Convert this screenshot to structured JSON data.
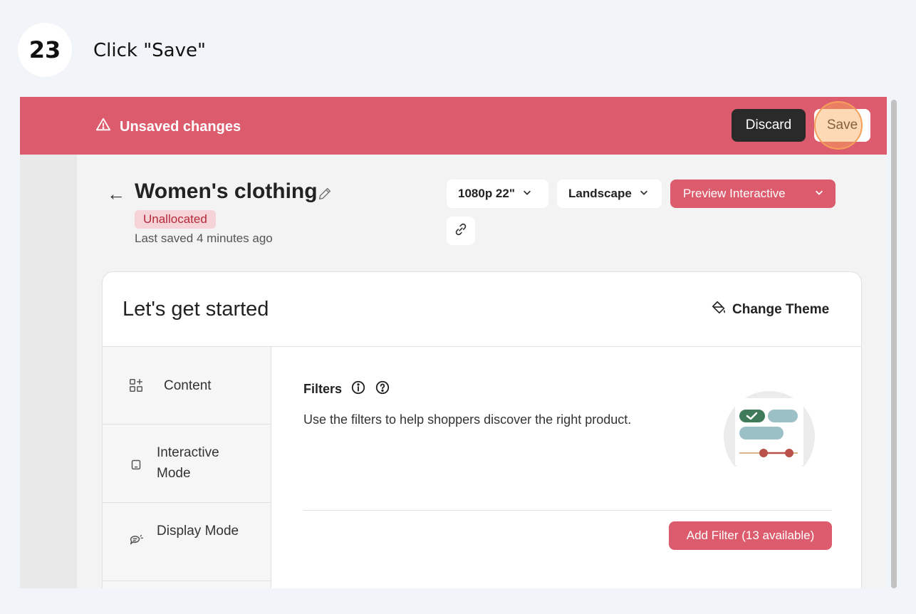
{
  "step": {
    "number": "23",
    "instruction": "Click \"Save\""
  },
  "banner": {
    "message": "Unsaved changes",
    "discard_label": "Discard",
    "save_label": "Save",
    "color": "#dc5b6c"
  },
  "header": {
    "title": "Women's clothing",
    "status": "Unallocated",
    "last_saved": "Last saved 4 minutes ago",
    "resolution": "1080p 22\"",
    "orientation": "Landscape",
    "preview_label": "Preview Interactive"
  },
  "card": {
    "title": "Let's get started",
    "change_theme_label": "Change Theme"
  },
  "sidebar": {
    "items": [
      {
        "label": "Content",
        "icon": "content-grid-icon"
      },
      {
        "label": "Interactive Mode",
        "icon": "tablet-icon"
      },
      {
        "label": "Display Mode",
        "icon": "display-chat-icon"
      }
    ]
  },
  "filters": {
    "title": "Filters",
    "description": "Use the filters to help shoppers discover the right product.",
    "add_filter_label": "Add Filter (13 available)"
  },
  "colors": {
    "accent": "#dc5b6c",
    "dark_button": "#2a2a2a",
    "status_badge_bg": "#f6d3d6",
    "status_badge_text": "#b3293b"
  }
}
